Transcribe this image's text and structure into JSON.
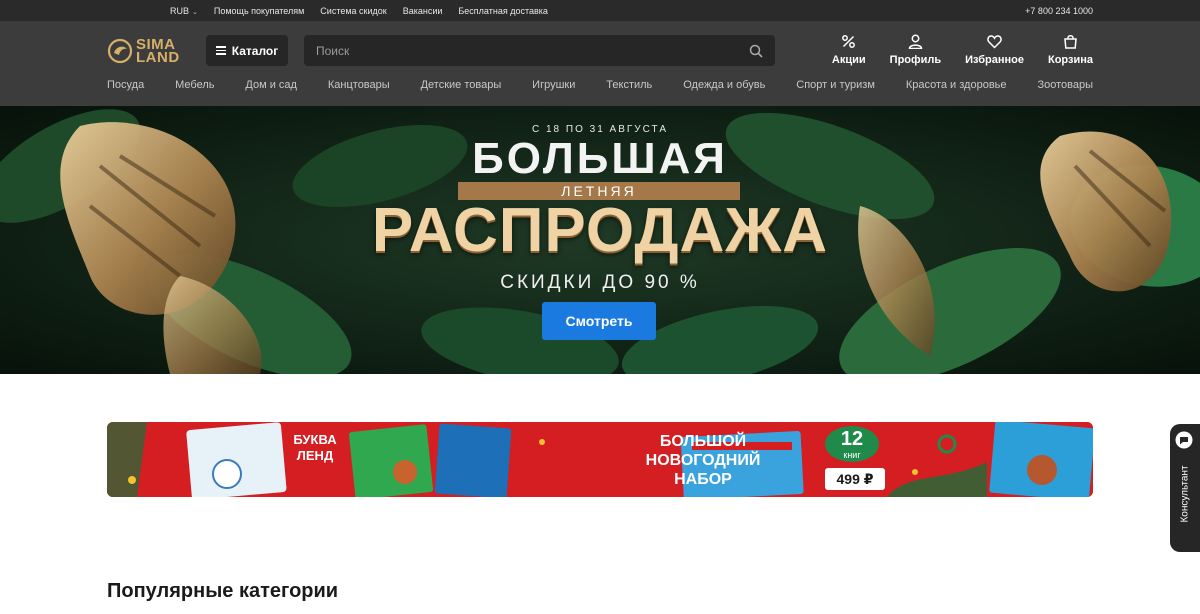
{
  "topbar": {
    "currency": "RUB",
    "links": [
      "Помощь покупателям",
      "Система скидок",
      "Вакансии",
      "Бесплатная доставка"
    ],
    "phone": "+7 800 234 1000"
  },
  "header": {
    "logo_line1": "SIMA",
    "logo_line2": "LAND",
    "catalog_label": "Каталог",
    "search_placeholder": "Поиск",
    "actions": {
      "promo": "Акции",
      "profile": "Профиль",
      "favorites": "Избранное",
      "cart": "Корзина"
    },
    "nav": [
      "Посуда",
      "Мебель",
      "Дом и сад",
      "Канцтовары",
      "Детские товары",
      "Игрушки",
      "Текстиль",
      "Одежда и обувь",
      "Спорт и туризм",
      "Красота и здоровье",
      "Зоотовары"
    ]
  },
  "hero": {
    "dates": "С 18 ПО 31 АВГУСТА",
    "title_big": "БОЛЬШАЯ",
    "title_summer": "ЛЕТНЯЯ",
    "title_sale": "РАСПРОДАЖА",
    "subtitle": "СКИДКИ ДО 90 %",
    "button_label": "Смотреть"
  },
  "promo": {
    "bukva_line1": "БУКВА",
    "bukva_line2": "ЛЕНД",
    "center_line1": "БОЛЬШОЙ",
    "center_line2": "НОВОГОДНИЙ",
    "center_line3": "НАБОР",
    "books_count": "12",
    "books_unit": "книг",
    "price": "499 ₽"
  },
  "consultant": {
    "label": "Консультант"
  },
  "sections": {
    "popular_title": "Популярные категории"
  },
  "colors": {
    "header_bg": "#3c3c3c",
    "topbar_bg": "#2a2a2a",
    "accent_blue": "#1a7ae0",
    "promo_red": "#d41e22",
    "logo_gold": "#d6b06a"
  }
}
